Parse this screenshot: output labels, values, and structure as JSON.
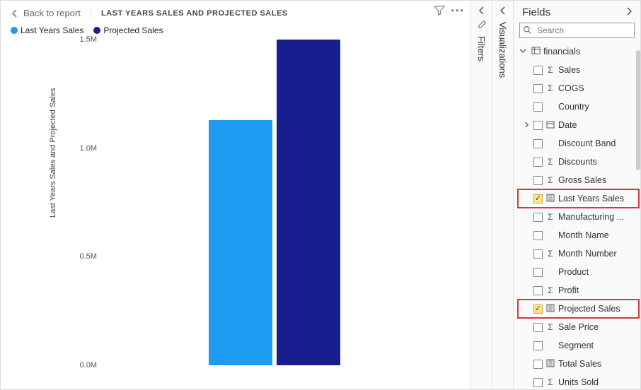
{
  "header": {
    "back_label": "Back to report",
    "title": "LAST YEARS SALES AND PROJECTED SALES"
  },
  "legend": [
    {
      "label": "Last Years Sales",
      "color": "#1d9bf0"
    },
    {
      "label": "Projected Sales",
      "color": "#191e8e"
    }
  ],
  "y_axis_label": "Last Years Sales and Projected Sales",
  "chart_data": {
    "type": "bar",
    "categories": [
      ""
    ],
    "series": [
      {
        "name": "Last Years Sales",
        "values": [
          1130000
        ],
        "color": "#1d9bf0"
      },
      {
        "name": "Projected Sales",
        "values": [
          1500000
        ],
        "color": "#191e8e"
      }
    ],
    "ylabel": "Last Years Sales and Projected Sales",
    "xlabel": "",
    "title": "LAST YEARS SALES AND PROJECTED SALES",
    "y_ticks": [
      "0.0M",
      "0.5M",
      "1.0M",
      "1.5M"
    ],
    "ylim": [
      0,
      1500000
    ]
  },
  "panels": {
    "filters_label": "Filters",
    "visualizations_label": "Visualizations",
    "fields_title": "Fields",
    "search_placeholder": "Search"
  },
  "fields_tree": {
    "group": "financials",
    "items": [
      {
        "label": "Sales",
        "icon": "sigma",
        "checked": false,
        "expandable": false,
        "highlight": false
      },
      {
        "label": "COGS",
        "icon": "sigma",
        "checked": false,
        "expandable": false,
        "highlight": false
      },
      {
        "label": "Country",
        "icon": "",
        "checked": false,
        "expandable": false,
        "highlight": false
      },
      {
        "label": "Date",
        "icon": "date",
        "checked": false,
        "expandable": true,
        "highlight": false
      },
      {
        "label": "Discount Band",
        "icon": "",
        "checked": false,
        "expandable": false,
        "highlight": false
      },
      {
        "label": "Discounts",
        "icon": "sigma",
        "checked": false,
        "expandable": false,
        "highlight": false
      },
      {
        "label": "Gross Sales",
        "icon": "sigma",
        "checked": false,
        "expandable": false,
        "highlight": false
      },
      {
        "label": "Last Years Sales",
        "icon": "measure",
        "checked": true,
        "expandable": false,
        "highlight": true
      },
      {
        "label": "Manufacturing ...",
        "icon": "sigma",
        "checked": false,
        "expandable": false,
        "highlight": false
      },
      {
        "label": "Month Name",
        "icon": "",
        "checked": false,
        "expandable": false,
        "highlight": false
      },
      {
        "label": "Month Number",
        "icon": "sigma",
        "checked": false,
        "expandable": false,
        "highlight": false
      },
      {
        "label": "Product",
        "icon": "",
        "checked": false,
        "expandable": false,
        "highlight": false
      },
      {
        "label": "Profit",
        "icon": "sigma",
        "checked": false,
        "expandable": false,
        "highlight": false
      },
      {
        "label": "Projected Sales",
        "icon": "measure",
        "checked": true,
        "expandable": false,
        "highlight": true
      },
      {
        "label": "Sale Price",
        "icon": "sigma",
        "checked": false,
        "expandable": false,
        "highlight": false
      },
      {
        "label": "Segment",
        "icon": "",
        "checked": false,
        "expandable": false,
        "highlight": false
      },
      {
        "label": "Total Sales",
        "icon": "measure",
        "checked": false,
        "expandable": false,
        "highlight": false
      },
      {
        "label": "Units Sold",
        "icon": "sigma",
        "checked": false,
        "expandable": false,
        "highlight": false
      }
    ]
  }
}
